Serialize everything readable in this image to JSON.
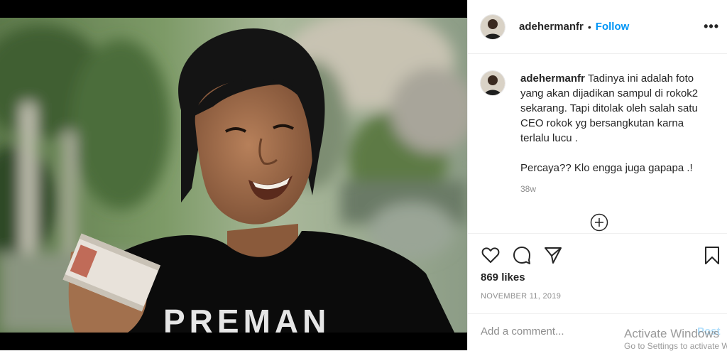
{
  "post": {
    "username": "adehermanfr",
    "dot": "•",
    "follow_label": "Follow",
    "more_label": "•••",
    "caption_line1": "Tadinya ini adalah foto yang akan dijadikan sampul di rokok2 sekarang. Tapi ditolak oleh salah satu CEO rokok yg bersangkutan karna terlalu lucu .",
    "caption_line2": "Percaya?? Klo engga juga gapapa .!",
    "time_ago": "38w",
    "likes": "869 likes",
    "date": "NOVEMBER 11, 2019",
    "shirt_text": "PREMAN"
  },
  "comment": {
    "placeholder": "Add a comment...",
    "post_label": "Post"
  },
  "watermark": {
    "title": "Activate Windows",
    "subtitle": "Go to Settings to activate Windows."
  },
  "icons": {
    "like": "heart-icon",
    "comment": "comment-icon",
    "share": "share-icon",
    "save": "bookmark-icon",
    "more": "more-options-icon",
    "load_more": "add-circle-icon"
  },
  "colors": {
    "follow": "#0095f6",
    "text": "#262626",
    "muted": "#8e8e8e"
  }
}
